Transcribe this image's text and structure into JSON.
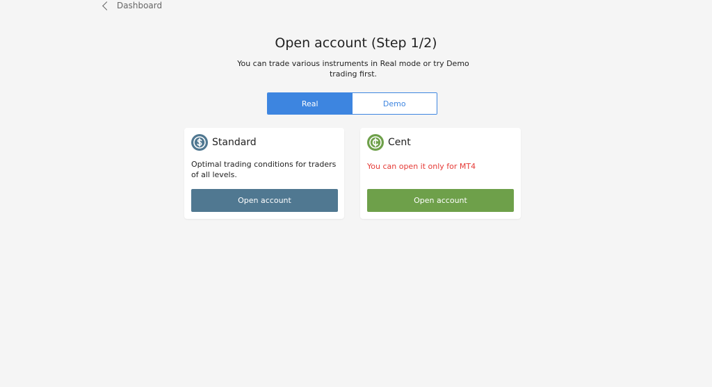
{
  "nav": {
    "back_label": "Dashboard"
  },
  "header": {
    "title": "Open account (Step 1/2)",
    "subtitle": "You can trade various instruments in Real mode or try Demo trading first."
  },
  "mode_toggle": {
    "tabs": [
      {
        "label": "Real",
        "active": true
      },
      {
        "label": "Demo",
        "active": false
      }
    ],
    "accent_color": "#3d85e0"
  },
  "accounts": [
    {
      "name": "Standard",
      "icon": "dollar-icon",
      "icon_color": "#507891",
      "description": "Optimal trading conditions for traders of all levels.",
      "button_label": "Open account",
      "button_color": "#507891"
    },
    {
      "name": "Cent",
      "icon": "cent-icon",
      "icon_color": "#6ea04a",
      "warning": "You can open it only for MT4",
      "warning_color": "#e53935",
      "button_label": "Open account",
      "button_color": "#6ea04a"
    }
  ]
}
